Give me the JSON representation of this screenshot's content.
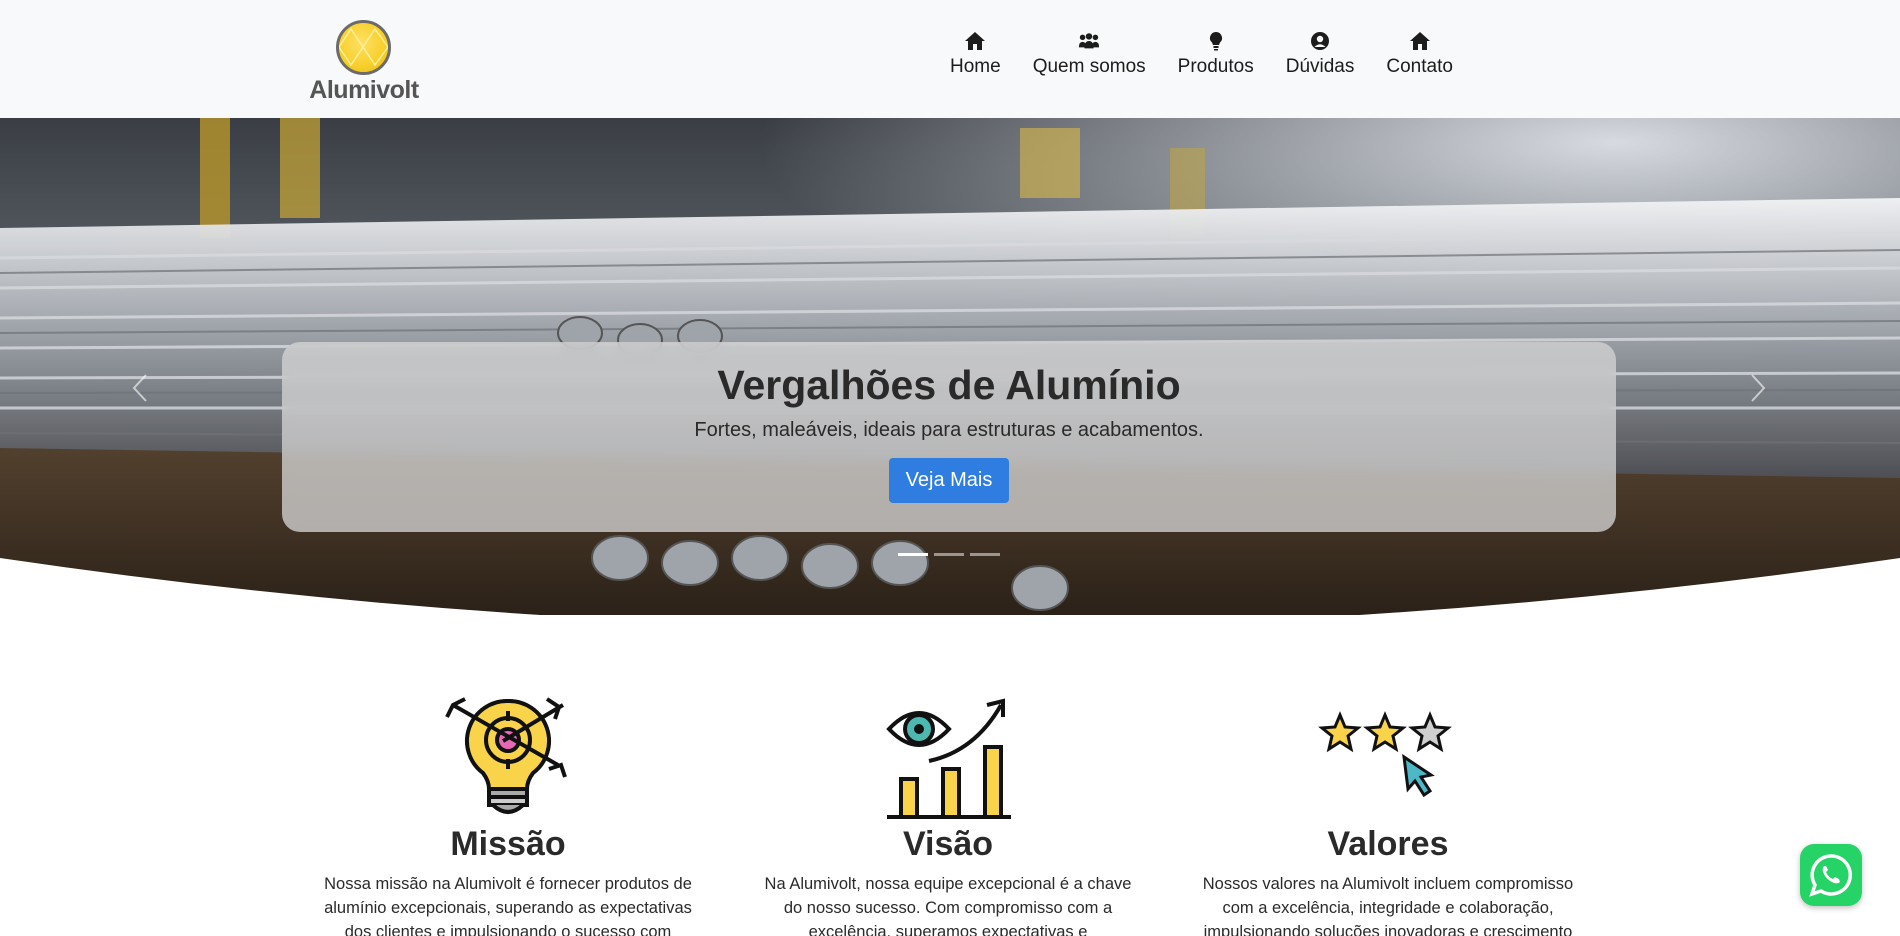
{
  "brand": {
    "name": "Alumivolt"
  },
  "nav": {
    "items": [
      {
        "label": "Home",
        "icon": "home-icon"
      },
      {
        "label": "Quem somos",
        "icon": "users-icon"
      },
      {
        "label": "Produtos",
        "icon": "lightbulb-icon"
      },
      {
        "label": "Dúvidas",
        "icon": "user-circle-icon"
      },
      {
        "label": "Contato",
        "icon": "home-icon"
      }
    ]
  },
  "hero": {
    "title": "Vergalhões de Alumínio",
    "subtitle": "Fortes, maleáveis, ideais para estruturas e acabamentos.",
    "button": "Veja Mais",
    "slides_count": 3,
    "active_slide": 1
  },
  "features": [
    {
      "title": "Missão",
      "icon": "lightbulb-target-icon",
      "text": "Nossa missão na Alumivolt é fornecer produtos de alumínio excepcionais, superando as expectativas dos clientes e impulsionando o sucesso com compromisso"
    },
    {
      "title": "Visão",
      "icon": "eye-growth-chart-icon",
      "text": "Na Alumivolt, nossa equipe excepcional é a chave do nosso sucesso. Com compromisso com a excelência, superamos expectativas e impulsionamos a empresa"
    },
    {
      "title": "Valores",
      "icon": "stars-rating-icon",
      "text": "Nossos valores na Alumivolt incluem compromisso com a excelência, integridade e colaboração, impulsionando soluções inovadoras e crescimento"
    }
  ],
  "colors": {
    "accent": "#2f7de1",
    "whatsapp": "#25d366",
    "header_bg": "#f8f9fa"
  }
}
